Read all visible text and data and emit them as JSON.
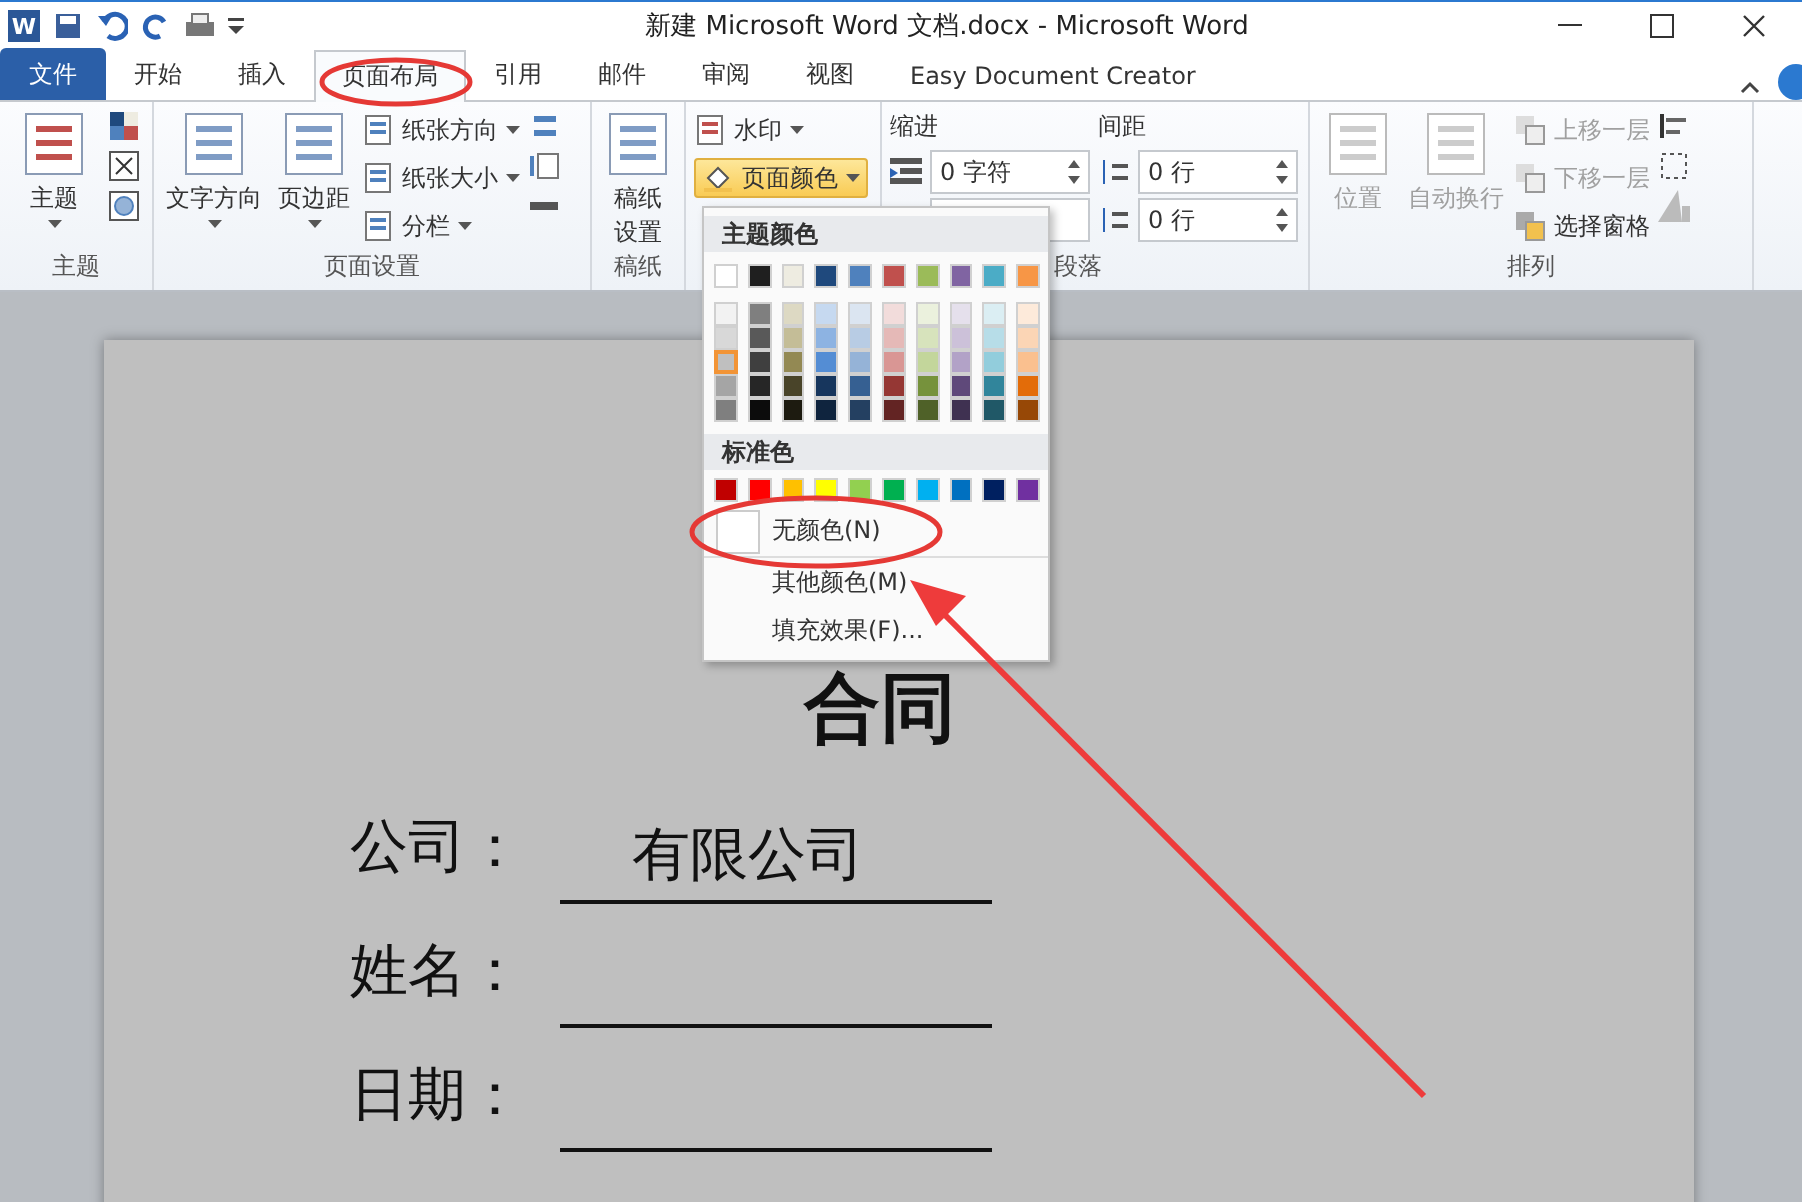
{
  "title_bar": {
    "app_icon": "W",
    "title": "新建 Microsoft Word 文档.docx - Microsoft Word"
  },
  "tabs": [
    {
      "label": "文件",
      "kind": "file",
      "selected": false
    },
    {
      "label": "开始",
      "kind": "tab",
      "selected": false
    },
    {
      "label": "插入",
      "kind": "tab",
      "selected": false
    },
    {
      "label": "页面布局",
      "kind": "tab",
      "selected": true
    },
    {
      "label": "引用",
      "kind": "tab",
      "selected": false
    },
    {
      "label": "邮件",
      "kind": "tab",
      "selected": false
    },
    {
      "label": "审阅",
      "kind": "tab",
      "selected": false
    },
    {
      "label": "视图",
      "kind": "tab",
      "selected": false
    },
    {
      "label": "Easy Document Creator",
      "kind": "tab",
      "selected": false
    }
  ],
  "theme_group": {
    "label": "主题",
    "button": "主题"
  },
  "page_setup": {
    "label": "页面设置",
    "big_buttons": [
      "文字方向",
      "页边距"
    ],
    "small_buttons": [
      "纸张方向",
      "纸张大小",
      "分栏"
    ]
  },
  "draft_group": {
    "label": "稿纸",
    "button_lines": [
      "稿纸",
      "设置"
    ]
  },
  "page_background": {
    "watermark": "水印",
    "page_color": {
      "label": "页面颜色",
      "active": true
    }
  },
  "paragraph": {
    "label": "段落",
    "indent_title": "缩进",
    "indent_left": "0 字符",
    "spacing_title": "间距",
    "spacing_before": "0 行",
    "spacing_after": "0 行"
  },
  "arrange": {
    "label": "排列",
    "big_buttons": [
      {
        "label": "位置",
        "disabled": true
      },
      {
        "label": "自动换行",
        "disabled": true
      }
    ],
    "small_buttons": [
      {
        "label": "上移一层",
        "disabled": true
      },
      {
        "label": "下移一层",
        "disabled": true
      },
      {
        "label": "选择窗格",
        "disabled": false
      }
    ]
  },
  "color_menu": {
    "theme_title": "主题颜色",
    "theme_colors": [
      {
        "color": "#ffffff",
        "selected": false
      },
      {
        "color": "#1f1f1f",
        "selected": false
      },
      {
        "color": "#eeece1",
        "selected": false
      },
      {
        "color": "#1f497d",
        "selected": false
      },
      {
        "color": "#4f81bd",
        "selected": false
      },
      {
        "color": "#c0504d",
        "selected": false
      },
      {
        "color": "#9bbb59",
        "selected": false
      },
      {
        "color": "#8064a2",
        "selected": false
      },
      {
        "color": "#4bacc6",
        "selected": false
      },
      {
        "color": "#f79646",
        "selected": false
      }
    ],
    "shades": [
      [
        {
          "color": "#f2f2f2",
          "selected": false
        },
        {
          "color": "#7f7f7f",
          "selected": false
        },
        {
          "color": "#ddd9c3",
          "selected": false
        },
        {
          "color": "#c6d9f0",
          "selected": false
        },
        {
          "color": "#dbe5f1",
          "selected": false
        },
        {
          "color": "#f2dcdb",
          "selected": false
        },
        {
          "color": "#ebf1dd",
          "selected": false
        },
        {
          "color": "#e5e0ec",
          "selected": false
        },
        {
          "color": "#dbeef3",
          "selected": false
        },
        {
          "color": "#fdeada",
          "selected": false
        }
      ],
      [
        {
          "color": "#d8d8d8",
          "selected": false
        },
        {
          "color": "#595959",
          "selected": false
        },
        {
          "color": "#c4bd97",
          "selected": false
        },
        {
          "color": "#8db3e2",
          "selected": false
        },
        {
          "color": "#b8cce4",
          "selected": false
        },
        {
          "color": "#e5b9b7",
          "selected": false
        },
        {
          "color": "#d7e3bc",
          "selected": false
        },
        {
          "color": "#ccc1d9",
          "selected": false
        },
        {
          "color": "#b7dde8",
          "selected": false
        },
        {
          "color": "#fbd5b5",
          "selected": false
        }
      ],
      [
        {
          "color": "#bfbfbf",
          "selected": true
        },
        {
          "color": "#3f3f3f",
          "selected": false
        },
        {
          "color": "#938953",
          "selected": false
        },
        {
          "color": "#548dd4",
          "selected": false
        },
        {
          "color": "#95b3d7",
          "selected": false
        },
        {
          "color": "#d99694",
          "selected": false
        },
        {
          "color": "#c3d69b",
          "selected": false
        },
        {
          "color": "#b2a2c7",
          "selected": false
        },
        {
          "color": "#92cddc",
          "selected": false
        },
        {
          "color": "#fac08f",
          "selected": false
        }
      ],
      [
        {
          "color": "#a5a5a5",
          "selected": false
        },
        {
          "color": "#262626",
          "selected": false
        },
        {
          "color": "#494429",
          "selected": false
        },
        {
          "color": "#17365d",
          "selected": false
        },
        {
          "color": "#366092",
          "selected": false
        },
        {
          "color": "#953734",
          "selected": false
        },
        {
          "color": "#76923c",
          "selected": false
        },
        {
          "color": "#5f497a",
          "selected": false
        },
        {
          "color": "#31859b",
          "selected": false
        },
        {
          "color": "#e36c09",
          "selected": false
        }
      ],
      [
        {
          "color": "#7f7f7f",
          "selected": false
        },
        {
          "color": "#0c0c0c",
          "selected": false
        },
        {
          "color": "#1d1b10",
          "selected": false
        },
        {
          "color": "#0f243e",
          "selected": false
        },
        {
          "color": "#244061",
          "selected": false
        },
        {
          "color": "#632423",
          "selected": false
        },
        {
          "color": "#4f6128",
          "selected": false
        },
        {
          "color": "#3f3151",
          "selected": false
        },
        {
          "color": "#205867",
          "selected": false
        },
        {
          "color": "#974806",
          "selected": false
        }
      ]
    ],
    "standard_title": "标准色",
    "standard_colors": [
      {
        "color": "#c00000",
        "selected": false
      },
      {
        "color": "#ff0000",
        "selected": false
      },
      {
        "color": "#ffc000",
        "selected": false
      },
      {
        "color": "#ffff00",
        "selected": false
      },
      {
        "color": "#92d050",
        "selected": false
      },
      {
        "color": "#00b050",
        "selected": false
      },
      {
        "color": "#00b0f0",
        "selected": false
      },
      {
        "color": "#0070c0",
        "selected": false
      },
      {
        "color": "#002060",
        "selected": false
      },
      {
        "color": "#7030a0",
        "selected": false
      }
    ],
    "items": [
      {
        "label": "无颜色(N)",
        "kind": "no-color"
      },
      {
        "label": "其他颜色(M)",
        "kind": "plain"
      },
      {
        "label": "填充效果(F)...",
        "kind": "plain"
      }
    ]
  },
  "document": {
    "title": "合同",
    "fields": [
      {
        "label": "公司：",
        "value": "有限公司"
      },
      {
        "label": "姓名："
      },
      {
        "label": "日期："
      }
    ]
  }
}
